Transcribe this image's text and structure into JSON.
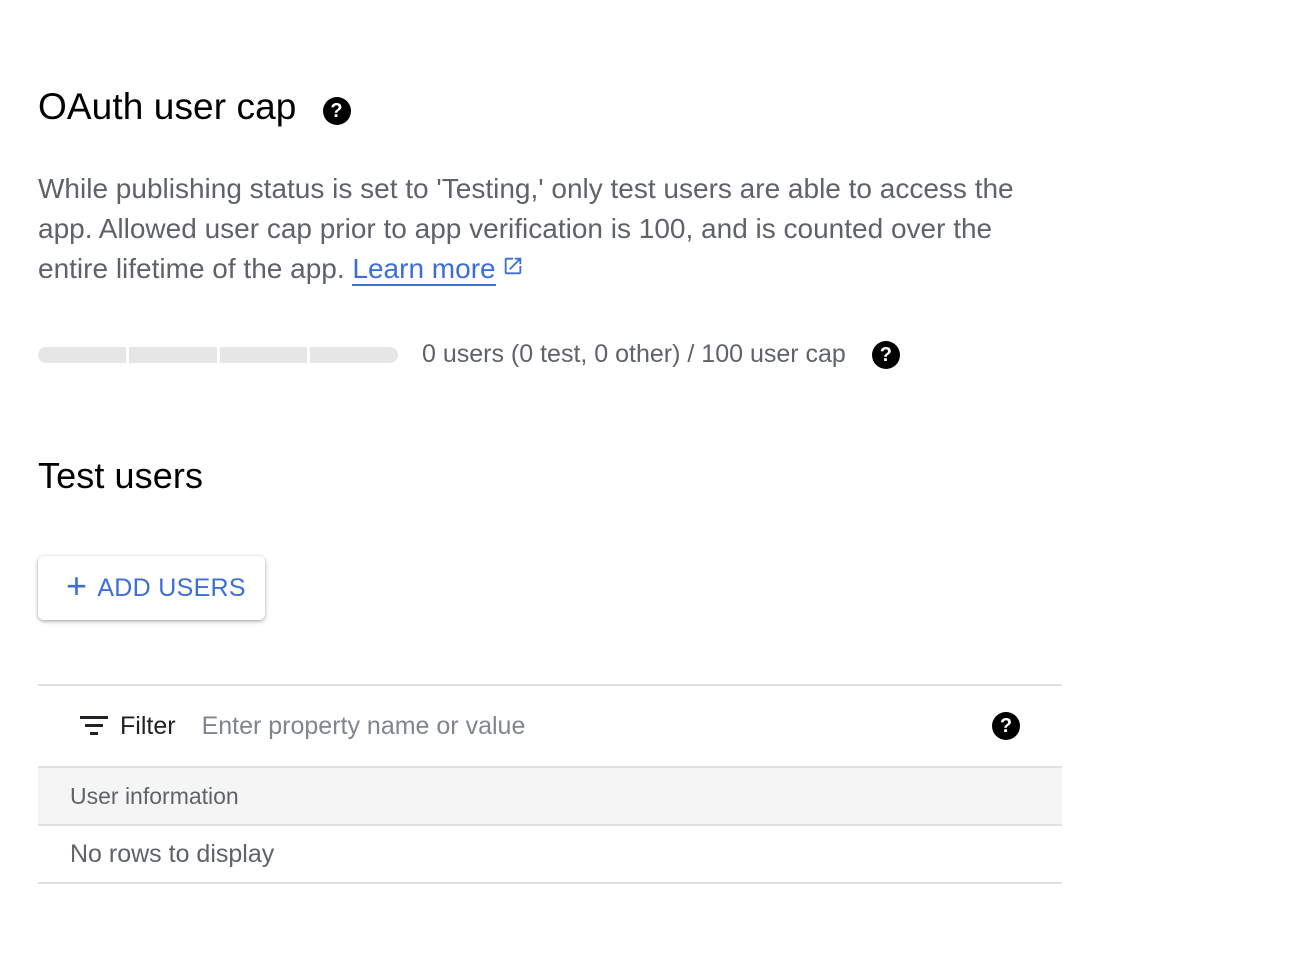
{
  "oauth_cap": {
    "title": "OAuth user cap",
    "description": "While publishing status is set to 'Testing,' only test users are able to access the app. Allowed user cap prior to app verification is 100, and is counted over the entire lifetime of the app.",
    "learn_more": "Learn more",
    "help_icon": "help-circle-icon",
    "external_icon": "external-link-icon"
  },
  "usage": {
    "segments": 4,
    "fill_fraction": 0,
    "summary": "0 users (0 test, 0 other) / 100 user cap",
    "help_icon": "help-circle-icon"
  },
  "test_users": {
    "title": "Test users",
    "add_button_icon": "plus-icon",
    "add_button_label": "ADD USERS"
  },
  "table": {
    "filter_icon": "filter-icon",
    "filter_label": "Filter",
    "filter_placeholder": "Enter property name or value",
    "filter_value": "",
    "help_icon": "help-circle-icon",
    "columns": [
      "User information"
    ],
    "rows": [],
    "empty_message": "No rows to display"
  },
  "colors": {
    "link": "#3c6fd6",
    "muted_text": "#5f6368",
    "progress_track": "#e6e6e6",
    "header_bg": "#f5f5f5",
    "border": "#e0e0e0"
  }
}
